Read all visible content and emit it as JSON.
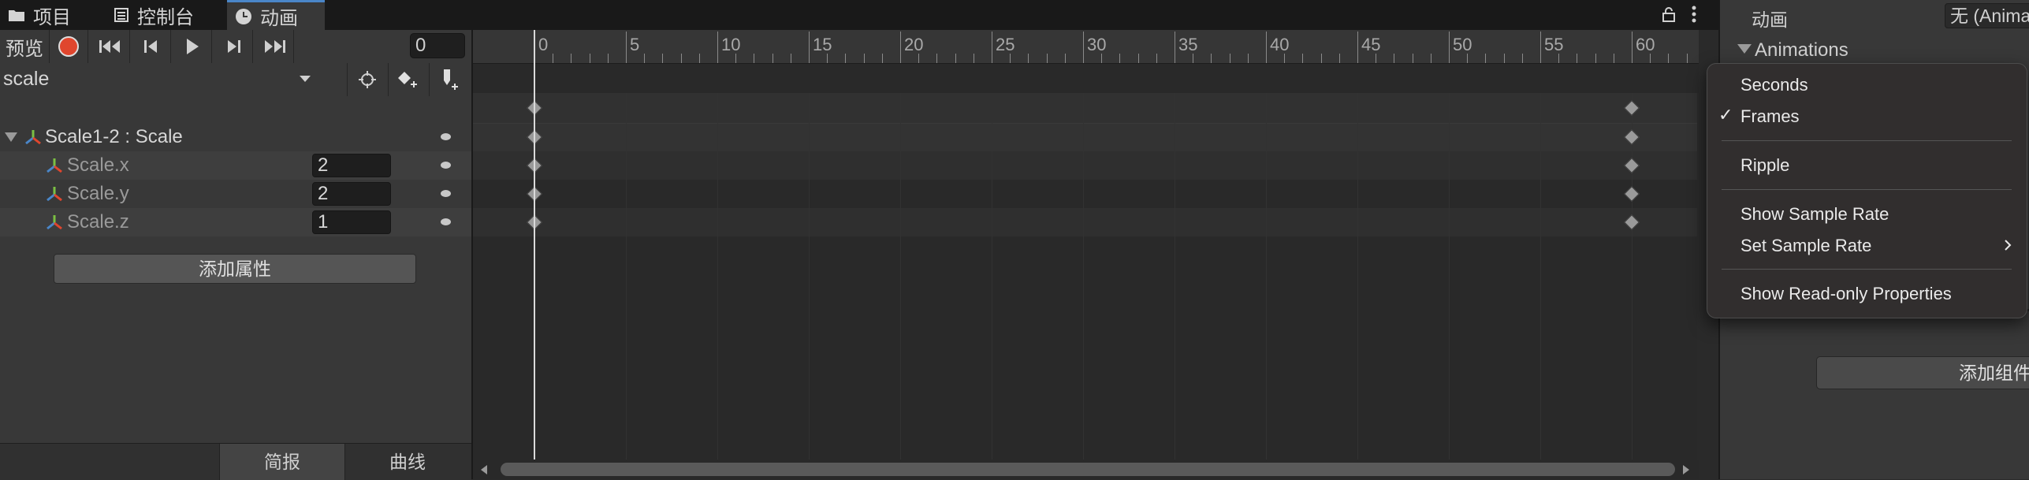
{
  "tabs": [
    {
      "label": "项目",
      "icon": "folder-icon"
    },
    {
      "label": "控制台",
      "icon": "console-icon"
    },
    {
      "label": "动画",
      "icon": "clock-icon"
    }
  ],
  "toolbar": {
    "preview_label": "预览",
    "current_frame": "0"
  },
  "clip": {
    "selected": "scale"
  },
  "properties": {
    "group_label": "Scale1-2 : Scale",
    "items": [
      {
        "label": "Scale.x",
        "value": "2"
      },
      {
        "label": "Scale.y",
        "value": "2"
      },
      {
        "label": "Scale.z",
        "value": "1"
      }
    ],
    "add_label": "添加属性"
  },
  "bottom_tabs": [
    "简报",
    "曲线"
  ],
  "ruler": {
    "labels": [
      "0",
      "5",
      "10",
      "15",
      "20",
      "25",
      "30",
      "35",
      "40",
      "45",
      "50",
      "55",
      "60"
    ]
  },
  "keyframes": {
    "frames": [
      0,
      60
    ]
  },
  "inspector": {
    "field_label": "动画",
    "field_value": "无 (Anima",
    "section_label": "Animations",
    "add_component_label": "添加组件"
  },
  "context_menu": {
    "items": [
      {
        "label": "Seconds",
        "checked": false
      },
      {
        "label": "Frames",
        "checked": true
      },
      {
        "label": "Ripple",
        "checked": false
      },
      {
        "label": "Show Sample Rate",
        "checked": false
      },
      {
        "label": "Set Sample Rate",
        "checked": false,
        "submenu": true
      },
      {
        "label": "Show Read-only Properties",
        "checked": false
      }
    ]
  },
  "colors": {
    "record": "#e0462e",
    "accent": "#4a86c8"
  }
}
